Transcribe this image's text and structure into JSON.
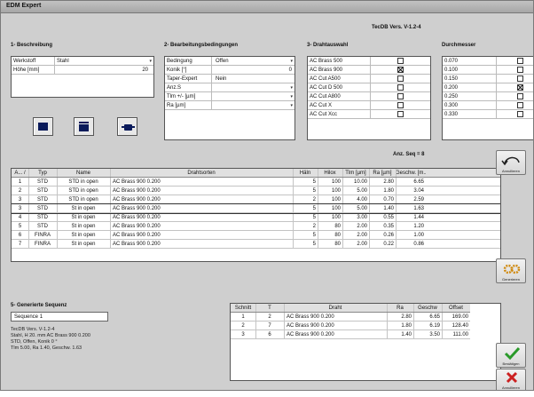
{
  "window": {
    "title": "EDM Expert",
    "version": "TecDB Vers. V-1.2-4"
  },
  "sections": {
    "beschreibung": "1- Beschreibung",
    "bearbeitung": "2- Bearbeitungsbedingungen",
    "drahtauswahl": "3- Drahtauswahl",
    "durchmesser": "Durchmesser",
    "generierte": "5- Generierte Sequenz"
  },
  "beschreibung": {
    "rows": [
      {
        "label": "Werkstoff",
        "value": "Stahl",
        "dropdown": true
      },
      {
        "label": "Höhe [mm]",
        "value": "20",
        "dropdown": false
      }
    ]
  },
  "bedingungen": {
    "rows": [
      {
        "label": "Bedingung",
        "value": "Offen",
        "extra": "",
        "dropdown": true
      },
      {
        "label": "Konik [°]",
        "value": "",
        "extra": "0",
        "dropdown": false
      },
      {
        "label": "Taper-Expert",
        "value": "Nein",
        "extra": "",
        "dropdown": false
      },
      {
        "label": "Anz.S",
        "value": "",
        "extra": "",
        "dropdown": true
      },
      {
        "label": "Tlm +/- [µm]",
        "value": "",
        "extra": "",
        "dropdown": true
      },
      {
        "label": "Ra [µm]",
        "value": "",
        "extra": "",
        "dropdown": true
      }
    ]
  },
  "drahtauswahl": {
    "items": [
      {
        "name": "AC Brass 500",
        "checked": false
      },
      {
        "name": "AC Brass 900",
        "checked": true
      },
      {
        "name": "AC Cut A500",
        "checked": false
      },
      {
        "name": "AC Cut D 500",
        "checked": false
      },
      {
        "name": "AC Cut A800",
        "checked": false
      },
      {
        "name": "AC Cut X",
        "checked": false
      },
      {
        "name": "AC Cut Xcc",
        "checked": false
      }
    ]
  },
  "durchmesser": {
    "items": [
      {
        "value": "0.070",
        "checked": false
      },
      {
        "value": "0.100",
        "checked": false
      },
      {
        "value": "0.150",
        "checked": false
      },
      {
        "value": "0.200",
        "checked": true
      },
      {
        "value": "0.250",
        "checked": false
      },
      {
        "value": "0.300",
        "checked": false
      },
      {
        "value": "0.330",
        "checked": false
      }
    ]
  },
  "anz_seq": "Anz. Seq = 8",
  "grid": {
    "headers": [
      "A... /",
      "Typ",
      "Name",
      "Drahtsorten",
      "Häln",
      "Hilox",
      "Tlm [µm]",
      "Ra [µm]",
      "Geschw. [m..."
    ],
    "rows": [
      [
        "1",
        "STD",
        "STD in open",
        "AC Brass 900 0.200",
        "5",
        "100",
        "10.00",
        "2.80",
        "6.65"
      ],
      [
        "2",
        "STD",
        "STD in open",
        "AC Brass 900 0.200",
        "5",
        "100",
        "5.00",
        "1.80",
        "3.04"
      ],
      [
        "3",
        "STD",
        "STD in open",
        "AC Brass 900 0.200",
        "2",
        "100",
        "4.00",
        "0.70",
        "2.59"
      ],
      [
        "3",
        "STD",
        "St in open",
        "AC Brass 900 0.200",
        "5",
        "100",
        "5.00",
        "1.40",
        "1.63"
      ],
      [
        "4",
        "STD",
        "St in open",
        "AC Brass 900 0.200",
        "5",
        "100",
        "3.00",
        "0.55",
        "1.44"
      ],
      [
        "5",
        "STD",
        "St in open",
        "AC Brass 900 0.200",
        "2",
        "80",
        "2.00",
        "0.35",
        "1.20"
      ],
      [
        "6",
        "FINRA",
        "St in open",
        "AC Brass 900 0.200",
        "5",
        "80",
        "2.00",
        "0.26",
        "1.00"
      ],
      [
        "7",
        "FINRA",
        "St in open",
        "AC Brass 900 0.200",
        "5",
        "80",
        "2.00",
        "0.22",
        "0.86"
      ]
    ],
    "selected_row": 3
  },
  "sequence": {
    "name": "Sequence 1",
    "info_lines": [
      "TecDB Vers.  V-1.2-4",
      "Stahl,  H 20. mm AC Brass 900 0.200",
      "STD,  Offen,  Konik 0 °",
      "Tlm 5.00,  Ra 1.40,  Geschw. 1.63"
    ]
  },
  "seqtable": {
    "headers": [
      "Schnitt",
      "T",
      "Draht",
      "Ra",
      "Geschw",
      "Offset"
    ],
    "rows": [
      [
        "1",
        "2",
        "AC Brass 900 0.200",
        "2.80",
        "6.65",
        "169.00"
      ],
      [
        "2",
        "7",
        "AC Brass 900 0.200",
        "1.80",
        "6.19",
        "128.40"
      ],
      [
        "3",
        "6",
        "AC Brass 900 0.200",
        "1.40",
        "3.50",
        "111.00"
      ]
    ]
  },
  "side_buttons": {
    "undo": "Annullieren",
    "generate": "Generieren",
    "confirm": "Bestätigen",
    "cancel": "Annullieren"
  },
  "colors": {
    "accent": "#0a1a5a",
    "confirm": "#2a9a2a",
    "cancel": "#cc2020",
    "generate": "#d08a10"
  }
}
